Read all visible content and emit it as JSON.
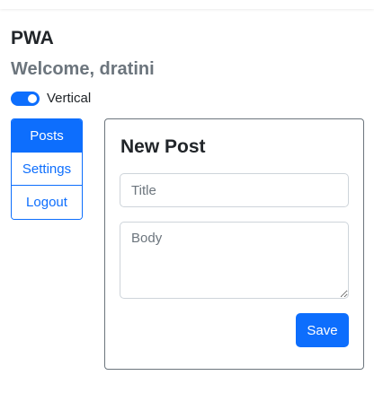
{
  "app": {
    "title": "PWA",
    "welcome": "Welcome, dratini"
  },
  "layout_toggle": {
    "label": "Vertical",
    "checked": true
  },
  "nav": {
    "items": [
      {
        "label": "Posts",
        "active": true
      },
      {
        "label": "Settings",
        "active": false
      },
      {
        "label": "Logout",
        "active": false
      }
    ]
  },
  "new_post": {
    "heading": "New Post",
    "title_placeholder": "Title",
    "title_value": "",
    "body_placeholder": "Body",
    "body_value": "",
    "save_label": "Save"
  },
  "colors": {
    "primary": "#0d6efd",
    "muted": "#6c757d",
    "text": "#212529",
    "input_border": "#ced4da"
  }
}
